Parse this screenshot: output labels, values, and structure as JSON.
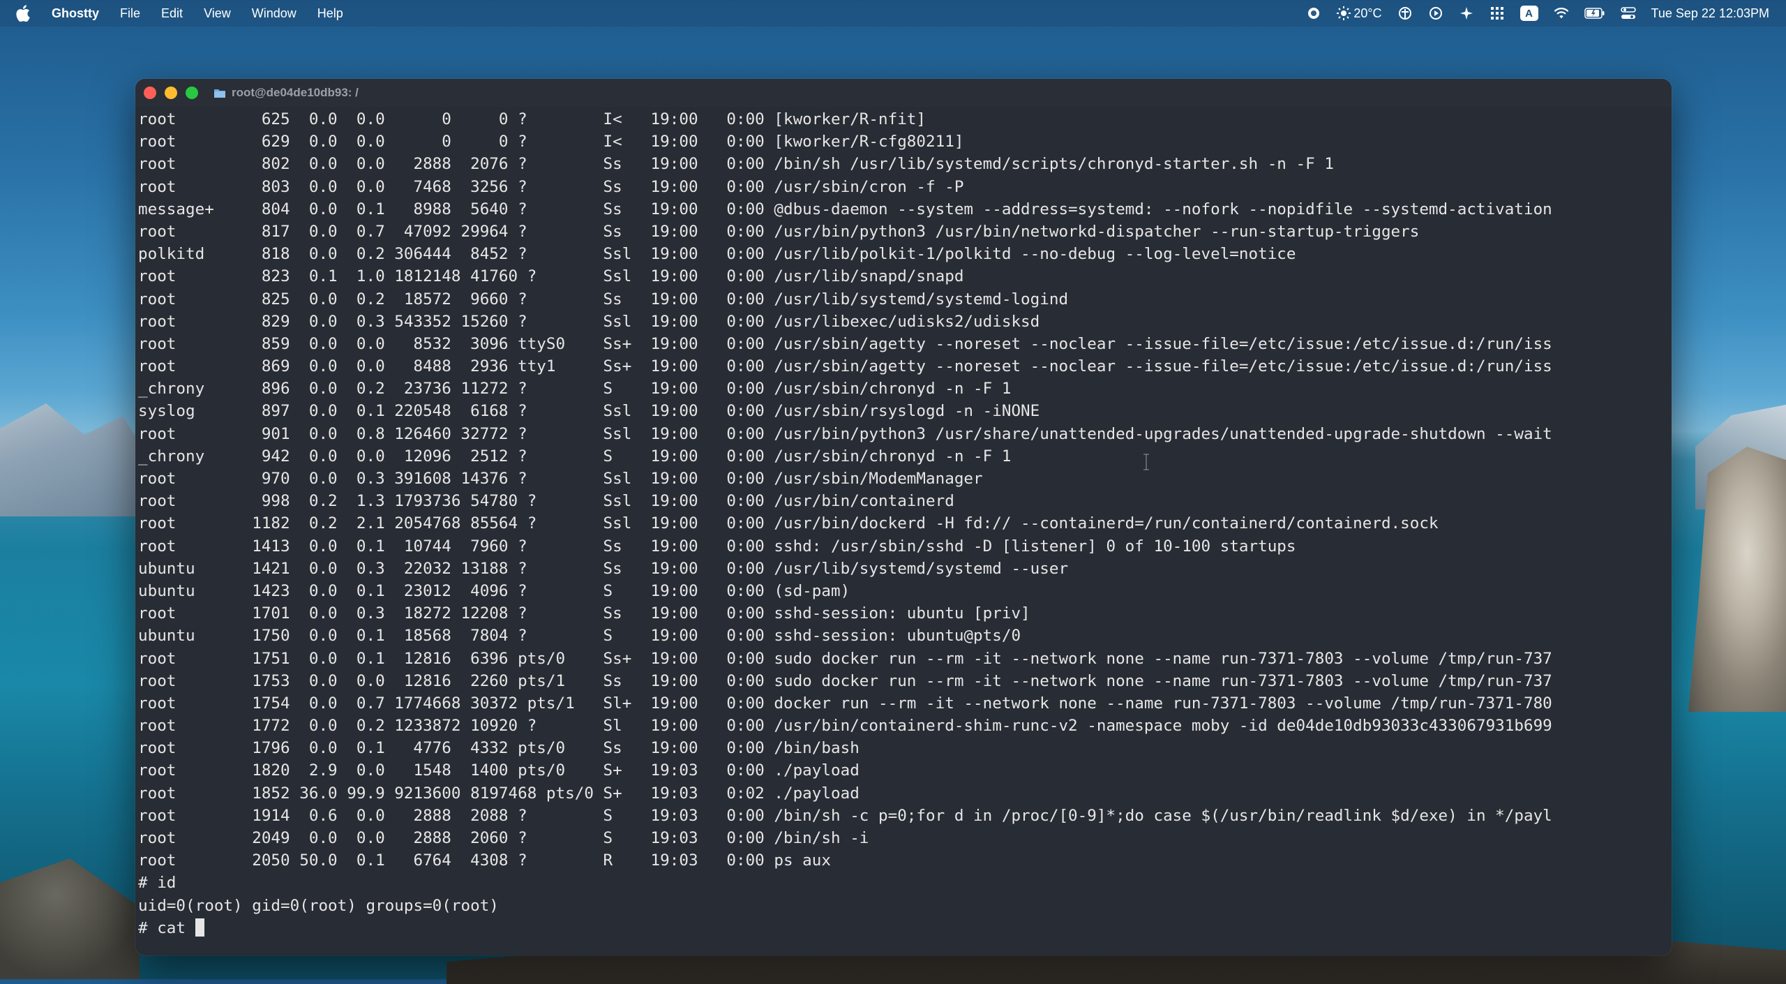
{
  "menubar": {
    "app_name": "Ghostty",
    "menus": [
      "File",
      "Edit",
      "View",
      "Window",
      "Help"
    ],
    "weather": "20°C",
    "input_source": "A",
    "datetime": "Tue Sep 22  12:03PM"
  },
  "window": {
    "title": "root@de04de10db93: /"
  },
  "terminal": {
    "lines": [
      "root         625  0.0  0.0      0     0 ?        I<   19:00   0:00 [kworker/R-nfit]",
      "root         629  0.0  0.0      0     0 ?        I<   19:00   0:00 [kworker/R-cfg80211]",
      "root         802  0.0  0.0   2888  2076 ?        Ss   19:00   0:00 /bin/sh /usr/lib/systemd/scripts/chronyd-starter.sh -n -F 1",
      "root         803  0.0  0.0   7468  3256 ?        Ss   19:00   0:00 /usr/sbin/cron -f -P",
      "message+     804  0.0  0.1   8988  5640 ?        Ss   19:00   0:00 @dbus-daemon --system --address=systemd: --nofork --nopidfile --systemd-activation",
      "root         817  0.0  0.7  47092 29964 ?        Ss   19:00   0:00 /usr/bin/python3 /usr/bin/networkd-dispatcher --run-startup-triggers",
      "polkitd      818  0.0  0.2 306444  8452 ?        Ssl  19:00   0:00 /usr/lib/polkit-1/polkitd --no-debug --log-level=notice",
      "root         823  0.1  1.0 1812148 41760 ?       Ssl  19:00   0:00 /usr/lib/snapd/snapd",
      "root         825  0.0  0.2  18572  9660 ?        Ss   19:00   0:00 /usr/lib/systemd/systemd-logind",
      "root         829  0.0  0.3 543352 15260 ?        Ssl  19:00   0:00 /usr/libexec/udisks2/udisksd",
      "root         859  0.0  0.0   8532  3096 ttyS0    Ss+  19:00   0:00 /usr/sbin/agetty --noreset --noclear --issue-file=/etc/issue:/etc/issue.d:/run/iss",
      "root         869  0.0  0.0   8488  2936 tty1     Ss+  19:00   0:00 /usr/sbin/agetty --noreset --noclear --issue-file=/etc/issue:/etc/issue.d:/run/iss",
      "_chrony      896  0.0  0.2  23736 11272 ?        S    19:00   0:00 /usr/sbin/chronyd -n -F 1",
      "syslog       897  0.0  0.1 220548  6168 ?        Ssl  19:00   0:00 /usr/sbin/rsyslogd -n -iNONE",
      "root         901  0.0  0.8 126460 32772 ?        Ssl  19:00   0:00 /usr/bin/python3 /usr/share/unattended-upgrades/unattended-upgrade-shutdown --wait",
      "_chrony      942  0.0  0.0  12096  2512 ?        S    19:00   0:00 /usr/sbin/chronyd -n -F 1",
      "root         970  0.0  0.3 391608 14376 ?        Ssl  19:00   0:00 /usr/sbin/ModemManager",
      "root         998  0.2  1.3 1793736 54780 ?       Ssl  19:00   0:00 /usr/bin/containerd",
      "root        1182  0.2  2.1 2054768 85564 ?       Ssl  19:00   0:00 /usr/bin/dockerd -H fd:// --containerd=/run/containerd/containerd.sock",
      "root        1413  0.0  0.1  10744  7960 ?        Ss   19:00   0:00 sshd: /usr/sbin/sshd -D [listener] 0 of 10-100 startups",
      "ubuntu      1421  0.0  0.3  22032 13188 ?        Ss   19:00   0:00 /usr/lib/systemd/systemd --user",
      "ubuntu      1423  0.0  0.1  23012  4096 ?        S    19:00   0:00 (sd-pam)",
      "root        1701  0.0  0.3  18272 12208 ?        Ss   19:00   0:00 sshd-session: ubuntu [priv]",
      "ubuntu      1750  0.0  0.1  18568  7804 ?        S    19:00   0:00 sshd-session: ubuntu@pts/0",
      "root        1751  0.0  0.1  12816  6396 pts/0    Ss+  19:00   0:00 sudo docker run --rm -it --network none --name run-7371-7803 --volume /tmp/run-737",
      "root        1753  0.0  0.0  12816  2260 pts/1    Ss   19:00   0:00 sudo docker run --rm -it --network none --name run-7371-7803 --volume /tmp/run-737",
      "root        1754  0.0  0.7 1774668 30372 pts/1   Sl+  19:00   0:00 docker run --rm -it --network none --name run-7371-7803 --volume /tmp/run-7371-780",
      "root        1772  0.0  0.2 1233872 10920 ?       Sl   19:00   0:00 /usr/bin/containerd-shim-runc-v2 -namespace moby -id de04de10db93033c433067931b699",
      "root        1796  0.0  0.1   4776  4332 pts/0    Ss   19:00   0:00 /bin/bash",
      "root        1820  2.9  0.0   1548  1400 pts/0    S+   19:03   0:00 ./payload",
      "root        1852 36.0 99.9 9213600 8197468 pts/0 S+   19:03   0:02 ./payload",
      "root        1914  0.6  0.0   2888  2088 ?        S    19:03   0:00 /bin/sh -c p=0;for d in /proc/[0-9]*;do case $(/usr/bin/readlink $d/exe) in */payl",
      "root        2049  0.0  0.0   2888  2060 ?        S    19:03   0:00 /bin/sh -i",
      "root        2050 50.0  0.1   6764  4308 ?        R    19:03   0:00 ps aux",
      "# id",
      "uid=0(root) gid=0(root) groups=0(root)"
    ],
    "prompt_line": "# cat "
  }
}
